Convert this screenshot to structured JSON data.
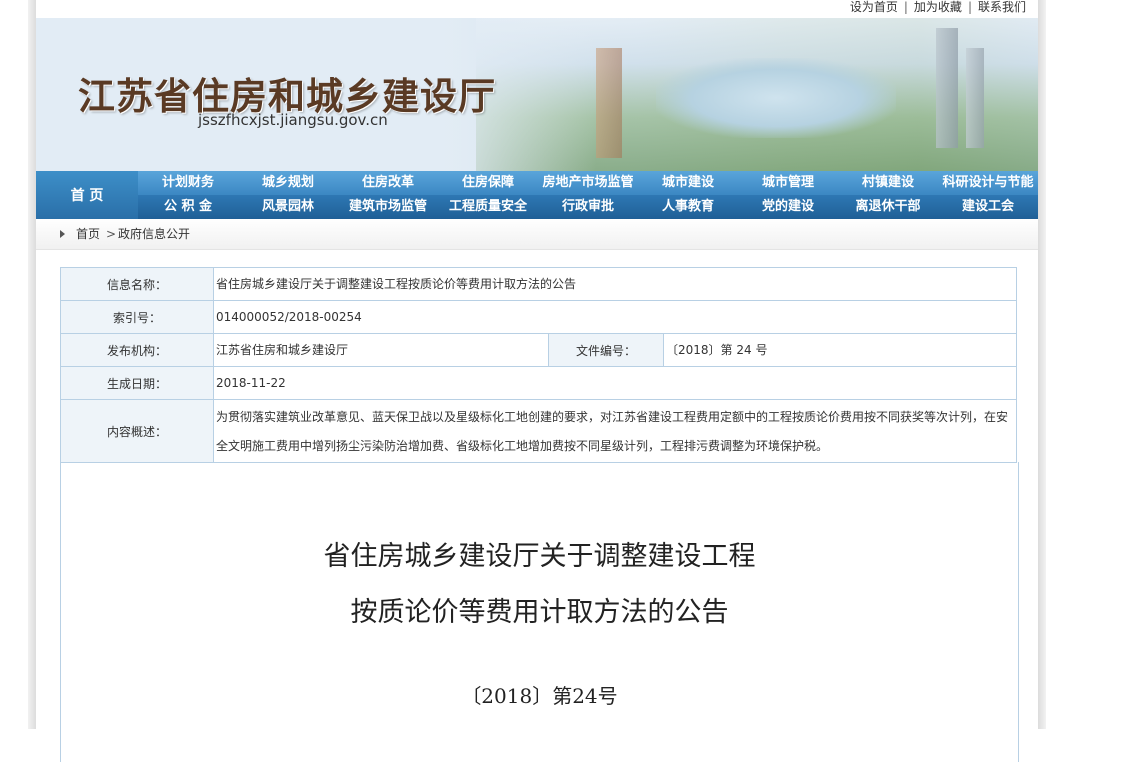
{
  "top_links": [
    "设为首页",
    "加为收藏",
    "联系我们"
  ],
  "banner": {
    "title": "江苏省住房和城乡建设厅",
    "url": "jsszfhcxjst.jiangsu.gov.cn"
  },
  "nav": {
    "home": "首 页",
    "row1": [
      "计划财务",
      "城乡规划",
      "住房改革",
      "住房保障",
      "房地产市场监管",
      "城市建设",
      "城市管理",
      "村镇建设",
      "科研设计与节能"
    ],
    "row2": [
      "公 积 金",
      "风景园林",
      "建筑市场监管",
      "工程质量安全",
      "行政审批",
      "人事教育",
      "党的建设",
      "离退休干部",
      "建设工会"
    ]
  },
  "breadcrumb": {
    "home": "首页",
    "separator": ">",
    "current": "政府信息公开"
  },
  "info": {
    "name_label": "信息名称：",
    "name_value": "省住房城乡建设厅关于调整建设工程按质论价等费用计取方法的公告",
    "index_label": "索引号：",
    "index_value": "014000052/2018-00254",
    "org_label": "发布机构：",
    "org_value": "江苏省住房和城乡建设厅",
    "docno_label": "文件编号：",
    "docno_value": "〔2018〕第 24 号",
    "date_label": "生成日期：",
    "date_value": "2018-11-22",
    "summary_label": "内容概述：",
    "summary_value": "为贯彻落实建筑业改革意见、蓝天保卫战以及星级标化工地创建的要求，对江苏省建设工程费用定额中的工程按质论价费用按不同获奖等次计列，在安全文明施工费用中增列扬尘污染防治增加费、省级标化工地增加费按不同星级计列，工程排污费调整为环境保护税。"
  },
  "document": {
    "title_line1": "省住房城乡建设厅关于调整建设工程",
    "title_line2": "按质论价等费用计取方法的公告",
    "number": "〔2018〕第24号"
  }
}
